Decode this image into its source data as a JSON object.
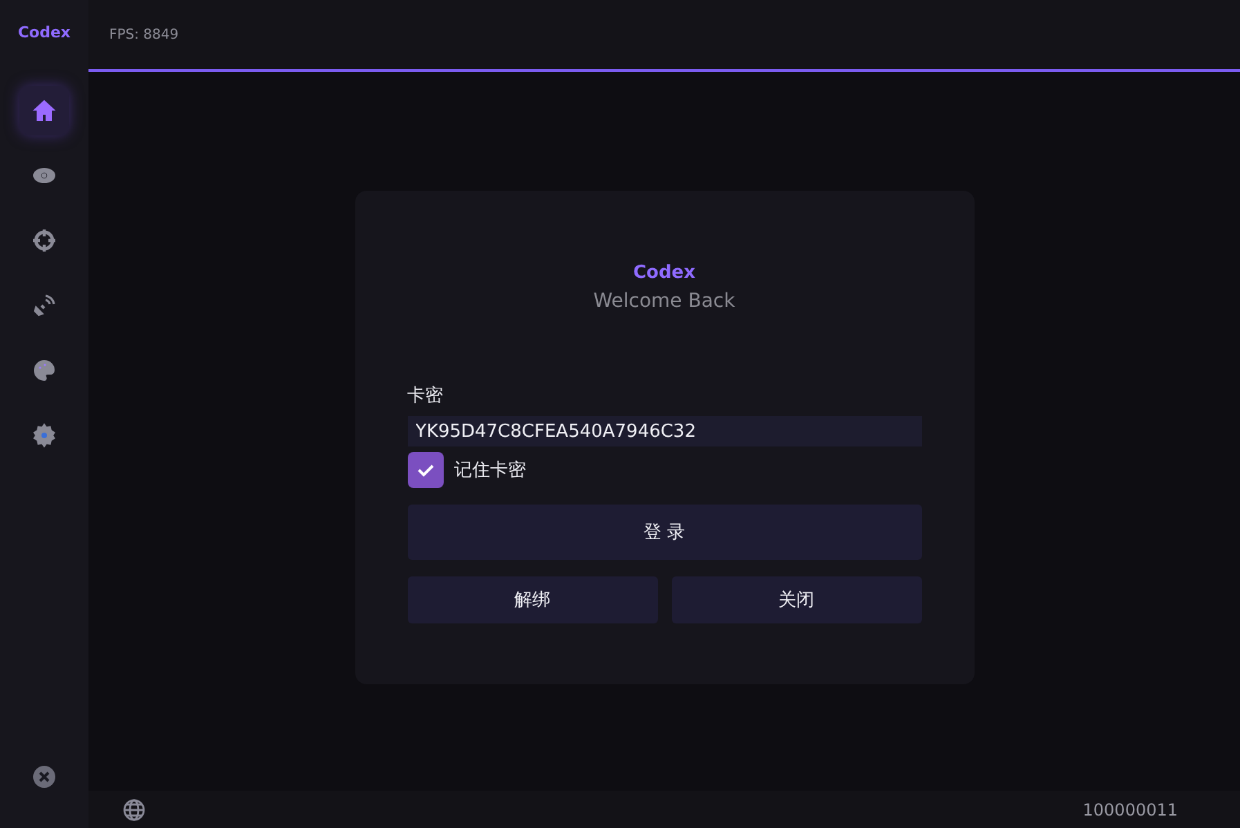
{
  "app": {
    "title": "Codex",
    "fps": "FPS: 8849"
  },
  "sidebar": {
    "items": [
      {
        "kind": "home",
        "selected": true
      },
      {
        "kind": "eye",
        "selected": false
      },
      {
        "kind": "crosshair",
        "selected": false
      },
      {
        "kind": "satellite",
        "selected": false
      },
      {
        "kind": "palette",
        "selected": false
      },
      {
        "kind": "gear",
        "selected": false
      }
    ]
  },
  "login": {
    "title": "Codex",
    "subtitle": "Welcome Back",
    "field_label": "卡密",
    "field_value": "YK95D47C8CFEA540A7946C32",
    "remember": {
      "label": "记住卡密",
      "checked": true
    },
    "primary_button": "登 录",
    "buttons": [
      "解绑",
      "关闭"
    ]
  },
  "status_bar": {
    "id": "100000011"
  }
}
